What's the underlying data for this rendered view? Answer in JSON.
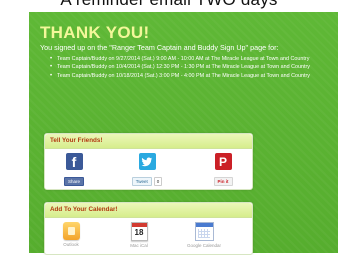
{
  "email": {
    "cropped_header": "A reminder email TWO days"
  },
  "confirmation": {
    "title": "THANK YOU!",
    "message": "You signed up on the \"Ranger Team Captain and Buddy Sign Up\" page for:",
    "events": [
      "Team Captain/Buddy on 9/27/2014 (Sat.) 9:00 AM - 10:00 AM at The Miracle League at Town and Country",
      "Team Captain/Buddy on 10/4/2014 (Sat.) 12:30 PM - 1:30 PM at The Miracle League at Town and Country",
      "Team Captain/Buddy on 10/18/2014 (Sat.) 3:00 PM - 4:00 PM at The Miracle League at Town and Country"
    ]
  },
  "share": {
    "heading": "Tell Your Friends!",
    "facebook": {
      "logo": "f",
      "button": "Share"
    },
    "twitter": {
      "button": "Tweet",
      "count": "0"
    },
    "pinterest": {
      "logo": "P",
      "button": "Pin it"
    }
  },
  "calendar": {
    "heading": "Add To Your Calendar!",
    "outlook": {
      "label": "Outlook"
    },
    "mac_ical": {
      "label": "Mac iCal",
      "day": "18"
    },
    "google": {
      "label": "Google Calendar"
    }
  },
  "colors": {
    "panel_green": "#5bb233",
    "title_yellow": "#f3f79a",
    "heading_orange": "#b03a10",
    "facebook_blue": "#3b5998",
    "twitter_blue": "#2aa9e0",
    "pinterest_red": "#cb2027"
  }
}
